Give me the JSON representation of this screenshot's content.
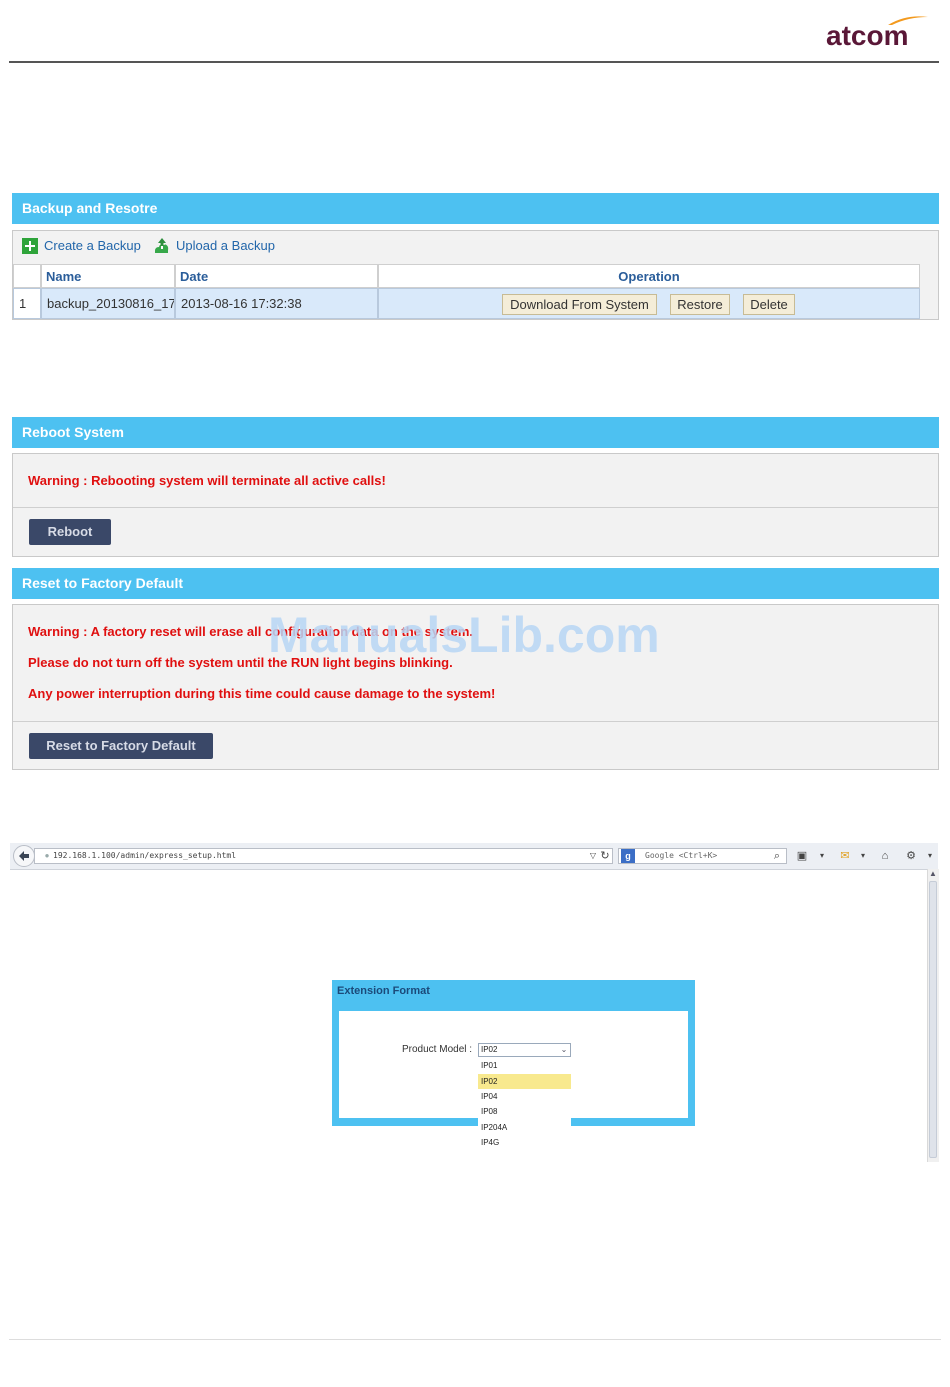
{
  "brand": {
    "logo_text": "atcom",
    "logo_color": "#5a1737",
    "swoosh_color": "#f39a1e"
  },
  "backup": {
    "title": "Backup and Resotre",
    "create_label": "Create a Backup",
    "upload_label": "Upload a Backup",
    "columns": {
      "index": "",
      "name": "Name",
      "date": "Date",
      "operation": "Operation"
    },
    "row": {
      "index": "1",
      "name": "backup_20130816_17",
      "date": "2013-08-16 17:32:38"
    },
    "buttons": {
      "download": "Download From System",
      "restore": "Restore",
      "delete": "Delete"
    }
  },
  "reboot": {
    "title": "Reboot System",
    "warning": "Warning : Rebooting system will terminate all active calls!",
    "button": "Reboot"
  },
  "factory": {
    "title": "Reset to Factory Default",
    "warnings": [
      "Warning : A factory reset will erase all configuration data on the system.",
      "Please do not turn off the system until the RUN light begins blinking.",
      "Any power interruption during this time could cause damage to the system!"
    ],
    "button": "Reset to Factory Default"
  },
  "watermark": "ManualsLib.com",
  "browser": {
    "url": "192.168.1.100/admin/express_setup.html",
    "search_placeholder": "Google <Ctrl+K>"
  },
  "extension": {
    "title": "Extension Format",
    "product_label": "Product Model :",
    "selected": "IP02",
    "options": [
      "IP01",
      "IP02",
      "IP04",
      "IP08",
      "IP204A",
      "IP4G"
    ]
  },
  "colors": {
    "header_blue": "#4dc1f1",
    "warning_red": "#e01010",
    "dark_button": "#3a4868"
  }
}
